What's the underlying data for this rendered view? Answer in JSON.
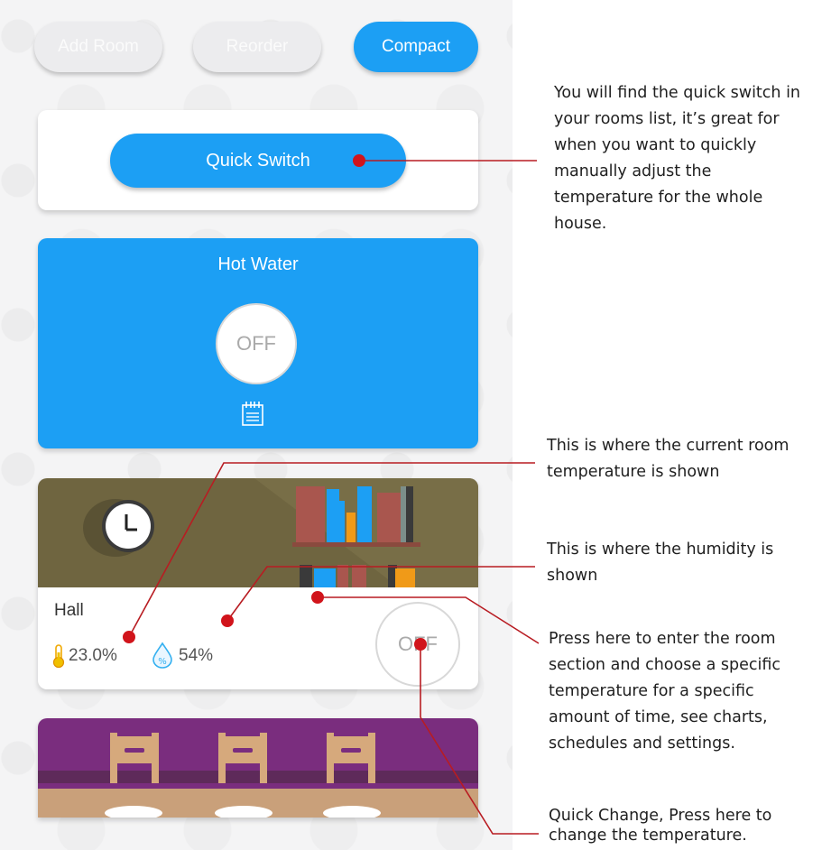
{
  "toolbar": {
    "add_room": "Add Room",
    "reorder": "Reorder",
    "compact": "Compact"
  },
  "quick_switch": {
    "label": "Quick Switch"
  },
  "hot_water": {
    "title": "Hot Water",
    "state": "OFF",
    "schedule_icon": "calendar-icon"
  },
  "hall": {
    "name": "Hall",
    "temperature": "23.0%",
    "humidity": "54%",
    "state": "OFF",
    "temperature_icon": "thermometer-icon",
    "humidity_icon": "humidity-drop-icon"
  },
  "annotations": {
    "quick_switch": "You will find the quick switch in your rooms list, it’s great for when you want to quickly manually adjust the temperature for the whole house.",
    "current_temp": "This is where the current room temperature is shown",
    "humidity": "This is where the humidity is shown",
    "room_section": "Press here to enter the room section and choose a specific temperature for a specific amount of time, see charts, schedules and settings.",
    "quick_change": "Quick Change, Press here to change the temperature."
  },
  "colors": {
    "accent": "#1c9ff4",
    "pointer": "#d1141b",
    "hall_header": "#6f6540",
    "dining_header": "#7a2d7e"
  }
}
